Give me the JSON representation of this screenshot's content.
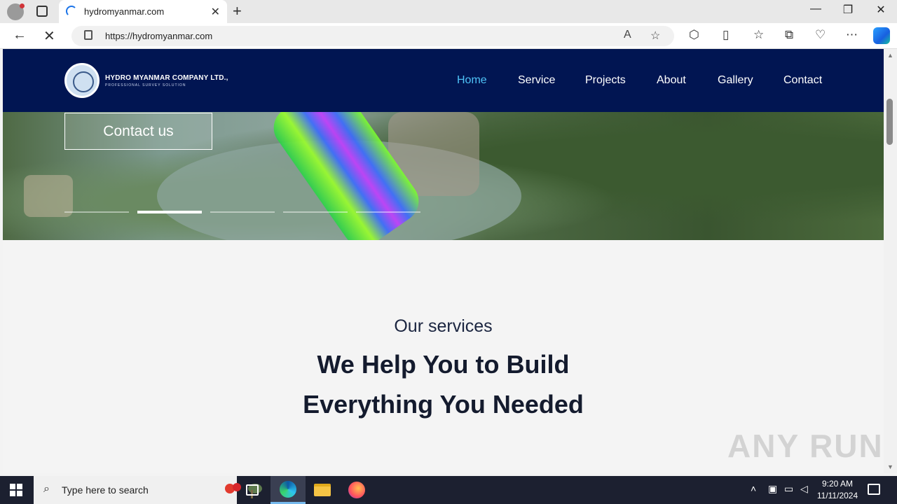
{
  "browser": {
    "tab_title": "hydromyanmar.com",
    "url": "https://hydromyanmar.com",
    "new_tab_label": "+",
    "close_tab_label": "✕",
    "window_controls": {
      "minimize": "—",
      "restore": "❐",
      "close": "✕"
    }
  },
  "site": {
    "company_name": "HYDRO MYANMAR COMPANY LTD.,",
    "tagline": "PROFESSIONAL SURVEY SOLUTION",
    "menu": [
      "Home",
      "Service",
      "Projects",
      "About",
      "Gallery",
      "Contact"
    ],
    "active_menu": "Home",
    "hero": {
      "cta_label": "Contact us",
      "slide_count": 5,
      "active_slide": 2
    },
    "services": {
      "subtitle": "Our services",
      "title_line1": "We Help You to Build",
      "title_line2": "Everything You Needed"
    },
    "watermark": "ANY RUN"
  },
  "taskbar": {
    "search_placeholder": "Type here to search",
    "time": "9:20 AM",
    "date": "11/11/2024"
  },
  "colors": {
    "nav_background": "#011552",
    "active_menu": "#4fc3f7",
    "heading": "#141b2e"
  }
}
